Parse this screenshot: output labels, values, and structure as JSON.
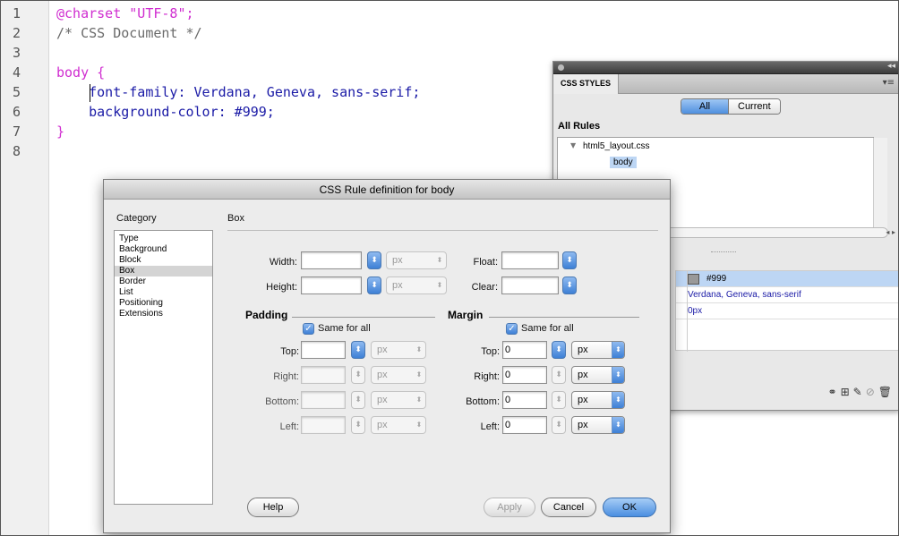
{
  "editor": {
    "line_numbers": [
      "1",
      "2",
      "3",
      "4",
      "5",
      "6",
      "7",
      "8"
    ],
    "lines": [
      "@charset \"UTF-8\";",
      "/* CSS Document */",
      "",
      "body {",
      "    font-family: Verdana, Geneva, sans-serif;",
      "    background-color: #999;",
      "}",
      ""
    ]
  },
  "css_panel": {
    "tab": "CSS STYLES",
    "toggle": {
      "all": "All",
      "current": "Current"
    },
    "section": "All Rules",
    "file": "html5_layout.css",
    "rule": "body",
    "properties": [
      {
        "value": "#999",
        "swatch": "#999999"
      },
      {
        "value": "Verdana, Geneva, sans-serif"
      },
      {
        "value": "0px"
      }
    ]
  },
  "dialog": {
    "title": "CSS Rule definition for body",
    "category_label": "Category",
    "categories": [
      "Type",
      "Background",
      "Block",
      "Box",
      "Border",
      "List",
      "Positioning",
      "Extensions"
    ],
    "selected_category": "Box",
    "section_title": "Box",
    "width_label": "Width:",
    "height_label": "Height:",
    "float_label": "Float:",
    "clear_label": "Clear:",
    "unit": "px",
    "padding": {
      "title": "Padding",
      "same_label": "Same for all",
      "top": "Top:",
      "right": "Right:",
      "bottom": "Bottom:",
      "left": "Left:"
    },
    "margin": {
      "title": "Margin",
      "same_label": "Same for all",
      "top": "Top:",
      "right": "Right:",
      "bottom": "Bottom:",
      "left": "Left:",
      "values": {
        "top": "0",
        "right": "0",
        "bottom": "0",
        "left": "0"
      }
    },
    "buttons": {
      "help": "Help",
      "apply": "Apply",
      "cancel": "Cancel",
      "ok": "OK"
    }
  }
}
